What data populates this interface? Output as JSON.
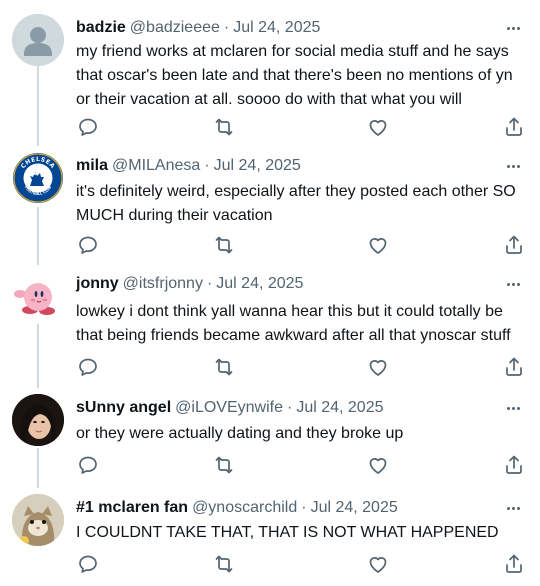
{
  "tweets": [
    {
      "name": "badzie",
      "handle": "@badzieeee",
      "separator": "·",
      "date": "Jul 24, 2025",
      "text": "my friend works at mclaren for social media stuff and he says that oscar's been late and that there's been no mentions of yn or their vacation at all. soooo do with that what you will",
      "avatar": "default-profile-avatar"
    },
    {
      "name": "mila",
      "handle": "@MILAnesa",
      "separator": "·",
      "date": "Jul 24, 2025",
      "text": "it's definitely weird, especially after they posted each other SO MUCH during their vacation",
      "avatar": "chelsea-crest-avatar",
      "avatar_text_top": "CHELSEA",
      "avatar_text_bottom": "FOOTBALL CLUB"
    },
    {
      "name": "jonny",
      "handle": "@itsfrjonny",
      "separator": "·",
      "date": "Jul 24, 2025",
      "text": "lowkey i dont think yall wanna hear this but it could totally be that being friends became awkward after all that ynoscar stuff",
      "avatar": "kirby-avatar"
    },
    {
      "name": "sUnny angel",
      "handle": "@iLOVEynwife",
      "separator": "·",
      "date": "Jul 24, 2025",
      "text": "or they were actually dating and they broke up",
      "avatar": "dark-hair-photo-avatar"
    },
    {
      "name": "#1 mclaren fan",
      "handle": "@ynoscarchild",
      "separator": "·",
      "date": "Jul 24, 2025",
      "text": "I COULDNT TAKE THAT, THAT IS NOT WHAT HAPPENED",
      "avatar": "cat-photo-avatar"
    }
  ],
  "colors": {
    "text": "#0f1419",
    "secondary": "#536471",
    "thread_line": "#cfd9de",
    "chelsea_blue": "#034694"
  }
}
